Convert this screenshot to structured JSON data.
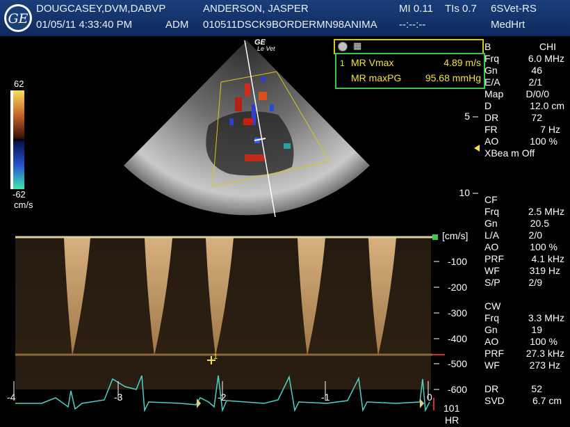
{
  "header": {
    "operator": "DOUGCASEY,DVM,DABVP",
    "patient": "ANDERSON, JASPER",
    "mi": "MI 0.11",
    "tis": "TIs 0.7",
    "probe": "6SVet-RS",
    "datetime": "01/05/11 4:33:40 PM",
    "adm": "ADM",
    "exam_id": "010511DSCK9BORDERMN98ANIMA",
    "timer": "--:--:--",
    "preset": "MedHrt"
  },
  "image_labels": {
    "brand": "GE",
    "brand_sub": "Le Vet"
  },
  "measurement": {
    "index": "1",
    "vmax_label": "MR Vmax",
    "vmax_value": "4.89 m/s",
    "pg_label": "MR maxPG",
    "pg_value": "95.68 mmHg"
  },
  "colorbar": {
    "top": "62",
    "bottom": "-62",
    "unit": "cm/s"
  },
  "depth_scale": {
    "mark5": "5",
    "mark10": "10"
  },
  "b_params": {
    "title": "B",
    "title_value": "CHI",
    "rows": [
      {
        "label": "Frq",
        "value": "6.0 MHz"
      },
      {
        "label": "Gn",
        "value": "46"
      },
      {
        "label": "E/A",
        "value": "2/1"
      },
      {
        "label": "Map",
        "value": "D/0/0"
      },
      {
        "label": "D",
        "value": "12.0 cm"
      },
      {
        "label": "DR",
        "value": "72"
      },
      {
        "label": "FR",
        "value": "7 Hz"
      },
      {
        "label": "AO",
        "value": "100 %"
      },
      {
        "label": "XBea m Off",
        "value": ""
      }
    ]
  },
  "cf_params": {
    "title": "CF",
    "rows": [
      {
        "label": "Frq",
        "value": "2.5 MHz"
      },
      {
        "label": "Gn",
        "value": "20.5"
      },
      {
        "label": "L/A",
        "value": "2/0"
      },
      {
        "label": "AO",
        "value": "100 %"
      },
      {
        "label": "PRF",
        "value": "4.1 kHz"
      },
      {
        "label": "WF",
        "value": "319 Hz"
      },
      {
        "label": "S/P",
        "value": "2/9"
      }
    ]
  },
  "cw_params": {
    "title": "CW",
    "rows": [
      {
        "label": "Frq",
        "value": "3.3 MHz"
      },
      {
        "label": "Gn",
        "value": "19"
      },
      {
        "label": "AO",
        "value": "100 %"
      },
      {
        "label": "PRF",
        "value": "27.3 kHz"
      },
      {
        "label": "WF",
        "value": "273 Hz"
      }
    ]
  },
  "bottom_params": {
    "rows": [
      {
        "label": "DR",
        "value": "52"
      },
      {
        "label": "SVD",
        "value": "6.7 cm"
      }
    ]
  },
  "doppler_scale": {
    "unit": "[cm/s]",
    "ticks": [
      "-100",
      "-200",
      "-300",
      "-400",
      "-500",
      "-600"
    ]
  },
  "cursor_label": "1",
  "ecg": {
    "time_ticks": [
      "-4",
      "-3",
      "-2",
      "-1",
      "0"
    ],
    "hr_value": "101",
    "hr_label": "HR",
    "trace_color": "#4fd1c5"
  },
  "colors": {
    "header_bg": "#1a3e7a",
    "measure_border": "#3cc64a",
    "measure_text": "#f4e33a",
    "baseline": "#d8d0a0"
  }
}
